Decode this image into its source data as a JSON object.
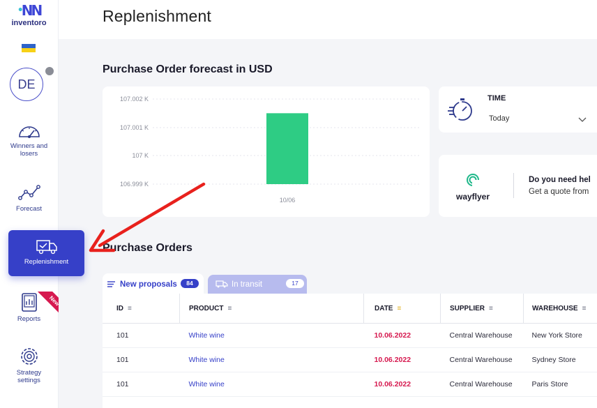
{
  "logo": {
    "text": "inventoro",
    "mark": "N"
  },
  "user": {
    "initials": "DE"
  },
  "nav": {
    "winners": "Winners and losers",
    "forecast": "Forecast",
    "replenishment": "Replenishment",
    "reports": "Reports",
    "reports_badge": "New",
    "strategy": "Strategy settings"
  },
  "page": {
    "title": "Replenishment"
  },
  "forecast": {
    "title": "Purchase Order forecast in USD",
    "chart_data": {
      "type": "bar",
      "categories": [
        "10/06"
      ],
      "values": [
        107.0015
      ],
      "title": "",
      "xlabel": "",
      "ylabel": "",
      "yticks": [
        "107.002 K",
        "107.001 K",
        "107 K",
        "106.999 K"
      ],
      "ytick_values": [
        107.002,
        107.001,
        107.0,
        106.999
      ],
      "bar_color": "#2ecc84"
    }
  },
  "time": {
    "label": "TIME",
    "value": "Today"
  },
  "wayflyer": {
    "name": "wayflyer",
    "title": "Do you need hel",
    "sub": "Get a quote from"
  },
  "orders": {
    "title": "Purchase Orders",
    "tabs": [
      {
        "label": "New proposals",
        "count": "84"
      },
      {
        "label": "In transit",
        "count": "17"
      }
    ],
    "columns": [
      "ID",
      "PRODUCT",
      "DATE",
      "SUPPLIER",
      "WAREHOUSE"
    ],
    "rows": [
      {
        "id": "101",
        "product": "White wine",
        "date": "10.06.2022",
        "supplier": "Central Warehouse",
        "warehouse": "New York Store"
      },
      {
        "id": "101",
        "product": "White wine",
        "date": "10.06.2022",
        "supplier": "Central Warehouse",
        "warehouse": "Sydney Store"
      },
      {
        "id": "101",
        "product": "White wine",
        "date": "10.06.2022",
        "supplier": "Central Warehouse",
        "warehouse": "Paris Store"
      }
    ]
  },
  "colors": {
    "accent": "#3640c8",
    "date": "#d6194f",
    "arrow": "#e8211d"
  }
}
